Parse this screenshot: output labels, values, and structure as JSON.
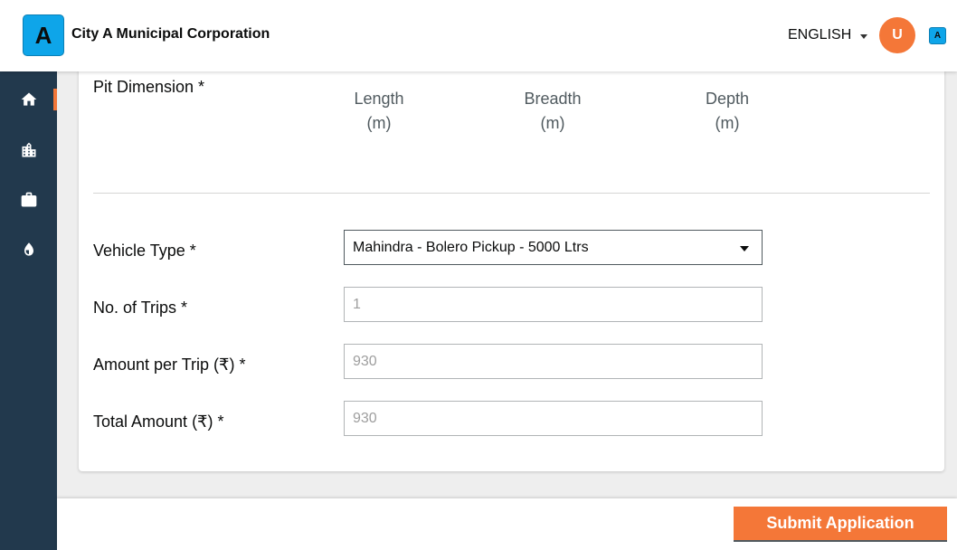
{
  "header": {
    "logo_letter": "A",
    "org_name": "City A Municipal Corporation",
    "language": "ENGLISH",
    "user_initial": "U",
    "mini_logo_letter": "A"
  },
  "sidebar": {
    "items": [
      {
        "icon": "home-icon",
        "active": true
      },
      {
        "icon": "city-icon",
        "active": false
      },
      {
        "icon": "briefcase-icon",
        "active": false
      },
      {
        "icon": "water-drop-icon",
        "active": false
      }
    ]
  },
  "form": {
    "pit_dimension_label": "Pit Dimension *",
    "length_label": "Length",
    "length_unit": "(m)",
    "breadth_label": "Breadth",
    "breadth_unit": "(m)",
    "depth_label": "Depth",
    "depth_unit": "(m)",
    "vehicle_type_label": "Vehicle Type *",
    "vehicle_type_value": "Mahindra - Bolero Pickup - 5000 Ltrs",
    "trips_label": "No. of Trips *",
    "trips_value": "1",
    "amount_per_trip_label": "Amount per Trip (₹) *",
    "amount_per_trip_value": "930",
    "total_amount_label": "Total Amount (₹) *",
    "total_amount_value": "930"
  },
  "footer": {
    "submit_label": "Submit Application"
  },
  "colors": {
    "accent": "#f47738",
    "sidebar": "#22394d",
    "brand": "#0ea5e9"
  }
}
